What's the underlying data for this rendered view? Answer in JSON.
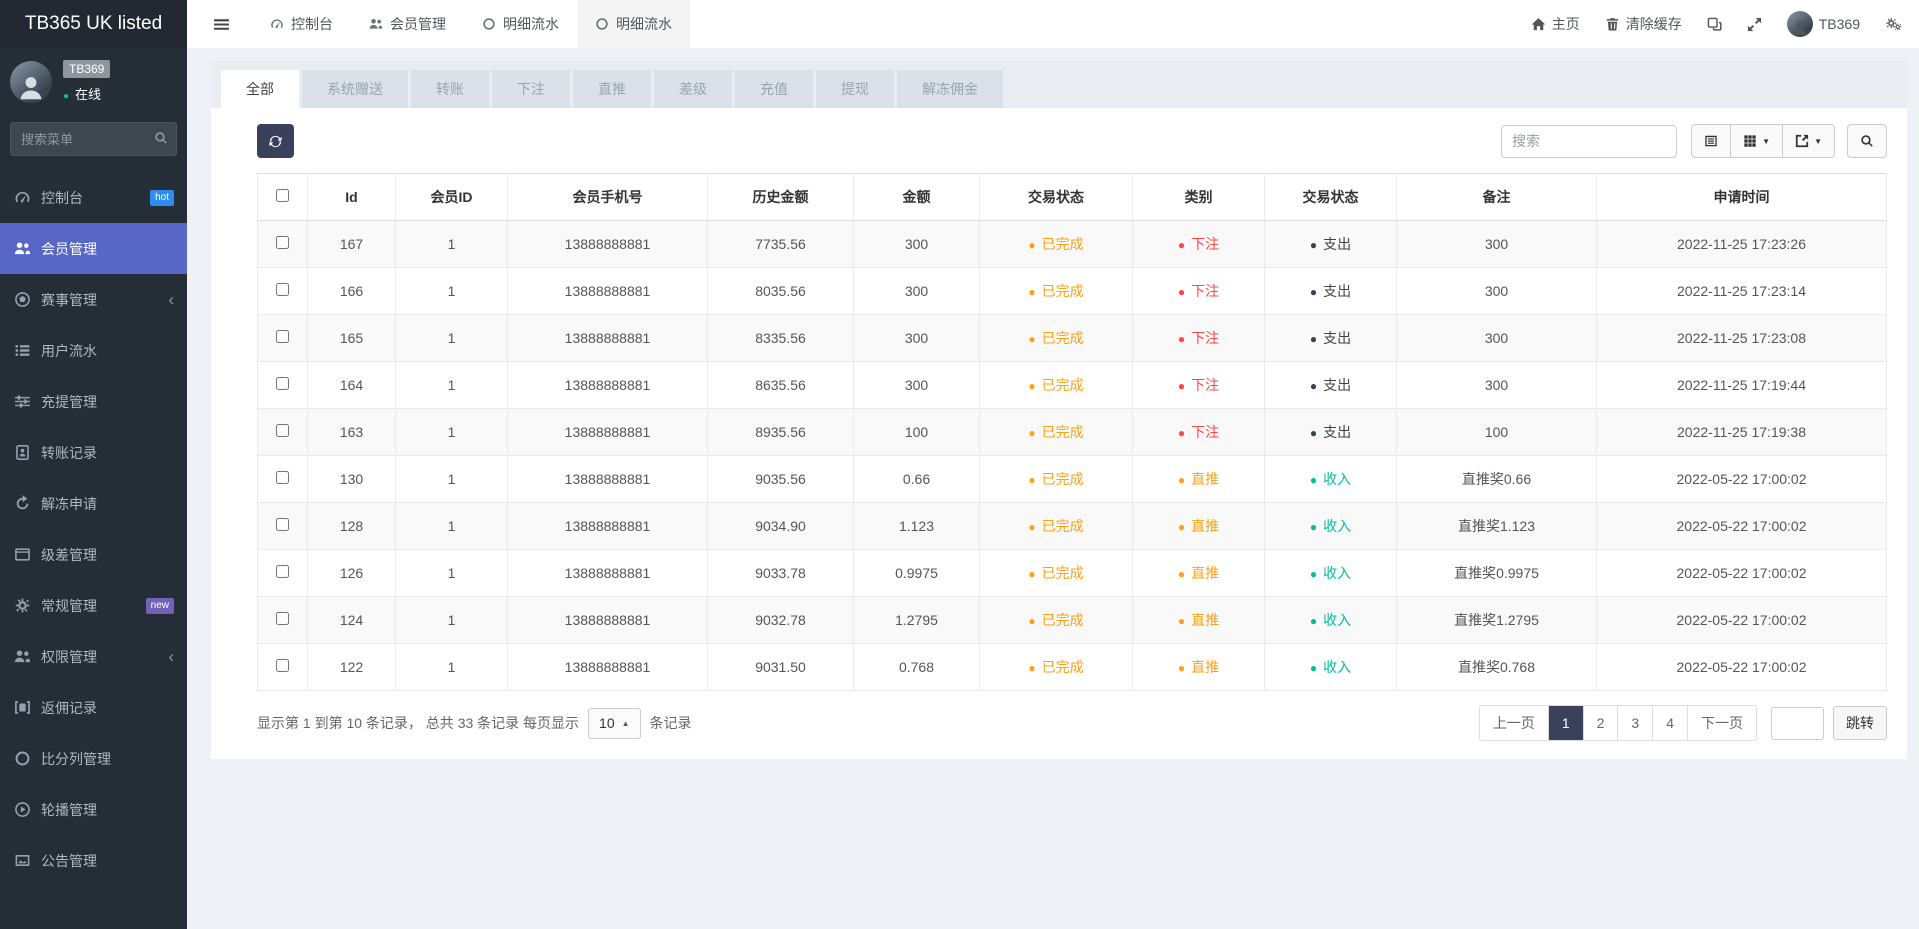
{
  "sidebar": {
    "brand": "TB365 UK listed",
    "user": {
      "name": "TB369",
      "status_label": "在线",
      "online_color": "#00c292"
    },
    "search_placeholder": "搜索菜单",
    "items": [
      {
        "label": "控制台",
        "icon": "gauge-icon",
        "badge": "hot",
        "badge_color": "#2d8cf0"
      },
      {
        "label": "会员管理",
        "icon": "users-icon",
        "active": true
      },
      {
        "label": "赛事管理",
        "icon": "football-icon",
        "expandable": true
      },
      {
        "label": "用户流水",
        "icon": "list-icon"
      },
      {
        "label": "充提管理",
        "icon": "sliders-icon"
      },
      {
        "label": "转账记录",
        "icon": "address-book-icon"
      },
      {
        "label": "解冻申请",
        "icon": "redo-icon"
      },
      {
        "label": "级差管理",
        "icon": "window-icon"
      },
      {
        "label": "常规管理",
        "icon": "gears-icon",
        "badge": "new",
        "badge_color": "#7162b8"
      },
      {
        "label": "权限管理",
        "icon": "users-icon",
        "expandable": true
      },
      {
        "label": "返佣记录",
        "icon": "commission-icon"
      },
      {
        "label": "比分列管理",
        "icon": "circle-icon"
      },
      {
        "label": "轮播管理",
        "icon": "carousel-icon"
      },
      {
        "label": "公告管理",
        "icon": "notice-icon"
      }
    ]
  },
  "topbar": {
    "nav_tabs": [
      {
        "label": "控制台",
        "icon": "gauge-icon"
      },
      {
        "label": "会员管理",
        "icon": "users-icon"
      },
      {
        "label": "明细流水",
        "icon": "circle-icon"
      },
      {
        "label": "明细流水",
        "icon": "circle-icon",
        "active": true
      }
    ],
    "home_label": "主页",
    "clear_cache_label": "清除缓存",
    "username": "TB369"
  },
  "filter_tabs": [
    {
      "label": "全部",
      "active": true
    },
    {
      "label": "系统赠送"
    },
    {
      "label": "转账"
    },
    {
      "label": "下注"
    },
    {
      "label": "直推"
    },
    {
      "label": "差级"
    },
    {
      "label": "充值"
    },
    {
      "label": "提现"
    },
    {
      "label": "解冻佣金"
    }
  ],
  "toolbar": {
    "search_placeholder": "搜索"
  },
  "table": {
    "columns": [
      "Id",
      "会员ID",
      "会员手机号",
      "历史金额",
      "金额",
      "交易状态",
      "类别",
      "交易状态",
      "备注",
      "申请时间"
    ],
    "dot_colors": {
      "已完成": "#ffa113",
      "下注": "#ff4545",
      "直推": "#ffa113",
      "支出": "#39415a",
      "收入": "#00c09a"
    },
    "text_colors": {
      "已完成": "#ffa113",
      "下注": "#ff4545",
      "直推": "#ffa113",
      "支出": "#444444",
      "收入": "#00c09a"
    },
    "rows": [
      {
        "id": "167",
        "member_id": "1",
        "phone": "13888888881",
        "history": "7735.56",
        "amount": "300",
        "status": "已完成",
        "category": "下注",
        "inout": "支出",
        "remark": "300",
        "time": "2022-11-25 17:23:26"
      },
      {
        "id": "166",
        "member_id": "1",
        "phone": "13888888881",
        "history": "8035.56",
        "amount": "300",
        "status": "已完成",
        "category": "下注",
        "inout": "支出",
        "remark": "300",
        "time": "2022-11-25 17:23:14"
      },
      {
        "id": "165",
        "member_id": "1",
        "phone": "13888888881",
        "history": "8335.56",
        "amount": "300",
        "status": "已完成",
        "category": "下注",
        "inout": "支出",
        "remark": "300",
        "time": "2022-11-25 17:23:08"
      },
      {
        "id": "164",
        "member_id": "1",
        "phone": "13888888881",
        "history": "8635.56",
        "amount": "300",
        "status": "已完成",
        "category": "下注",
        "inout": "支出",
        "remark": "300",
        "time": "2022-11-25 17:19:44"
      },
      {
        "id": "163",
        "member_id": "1",
        "phone": "13888888881",
        "history": "8935.56",
        "amount": "100",
        "status": "已完成",
        "category": "下注",
        "inout": "支出",
        "remark": "100",
        "time": "2022-11-25 17:19:38"
      },
      {
        "id": "130",
        "member_id": "1",
        "phone": "13888888881",
        "history": "9035.56",
        "amount": "0.66",
        "status": "已完成",
        "category": "直推",
        "inout": "收入",
        "remark": "直推奖0.66",
        "time": "2022-05-22 17:00:02"
      },
      {
        "id": "128",
        "member_id": "1",
        "phone": "13888888881",
        "history": "9034.90",
        "amount": "1.123",
        "status": "已完成",
        "category": "直推",
        "inout": "收入",
        "remark": "直推奖1.123",
        "time": "2022-05-22 17:00:02"
      },
      {
        "id": "126",
        "member_id": "1",
        "phone": "13888888881",
        "history": "9033.78",
        "amount": "0.9975",
        "status": "已完成",
        "category": "直推",
        "inout": "收入",
        "remark": "直推奖0.9975",
        "time": "2022-05-22 17:00:02"
      },
      {
        "id": "124",
        "member_id": "1",
        "phone": "13888888881",
        "history": "9032.78",
        "amount": "1.2795",
        "status": "已完成",
        "category": "直推",
        "inout": "收入",
        "remark": "直推奖1.2795",
        "time": "2022-05-22 17:00:02"
      },
      {
        "id": "122",
        "member_id": "1",
        "phone": "13888888881",
        "history": "9031.50",
        "amount": "0.768",
        "status": "已完成",
        "category": "直推",
        "inout": "收入",
        "remark": "直推奖0.768",
        "time": "2022-05-22 17:00:02"
      }
    ]
  },
  "footer": {
    "summary_prefix": "显示第 1 到第 10 条记录， 总共 33 条记录 每页显示",
    "page_size": "10",
    "summary_suffix": "条记录",
    "pagination": {
      "prev_label": "上一页",
      "pages": [
        "1",
        "2",
        "3",
        "4"
      ],
      "active_page": "1",
      "next_label": "下一页",
      "jump_label": "跳转"
    }
  }
}
